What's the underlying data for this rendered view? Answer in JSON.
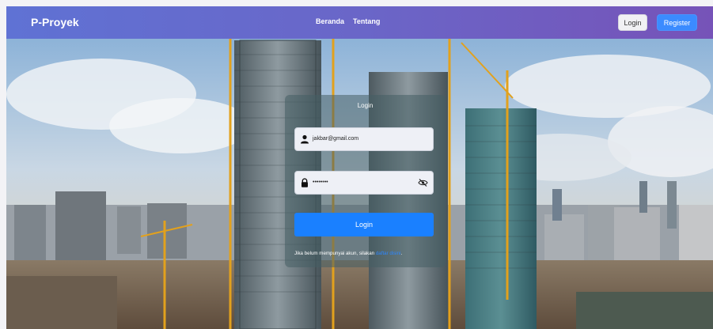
{
  "navbar": {
    "brand": "P-Proyek",
    "links": [
      "Beranda",
      "Tentang"
    ],
    "login_label": "Login",
    "register_label": "Register"
  },
  "login_card": {
    "title": "Login",
    "email_value": "jakbar@gmail.com",
    "password_value": "••••••••",
    "submit_label": "Login",
    "register_prompt": "Jika belum mempunyai akun, silakan",
    "register_link": "daftar disini",
    "register_suffix": "."
  },
  "icons": {
    "user": "user-icon",
    "lock": "lock-icon",
    "eye": "eye-slash-icon"
  },
  "colors": {
    "navbar_start": "#5f72d4",
    "navbar_end": "#7653b8",
    "primary": "#1a80ff",
    "register_button": "#3b8bff"
  }
}
